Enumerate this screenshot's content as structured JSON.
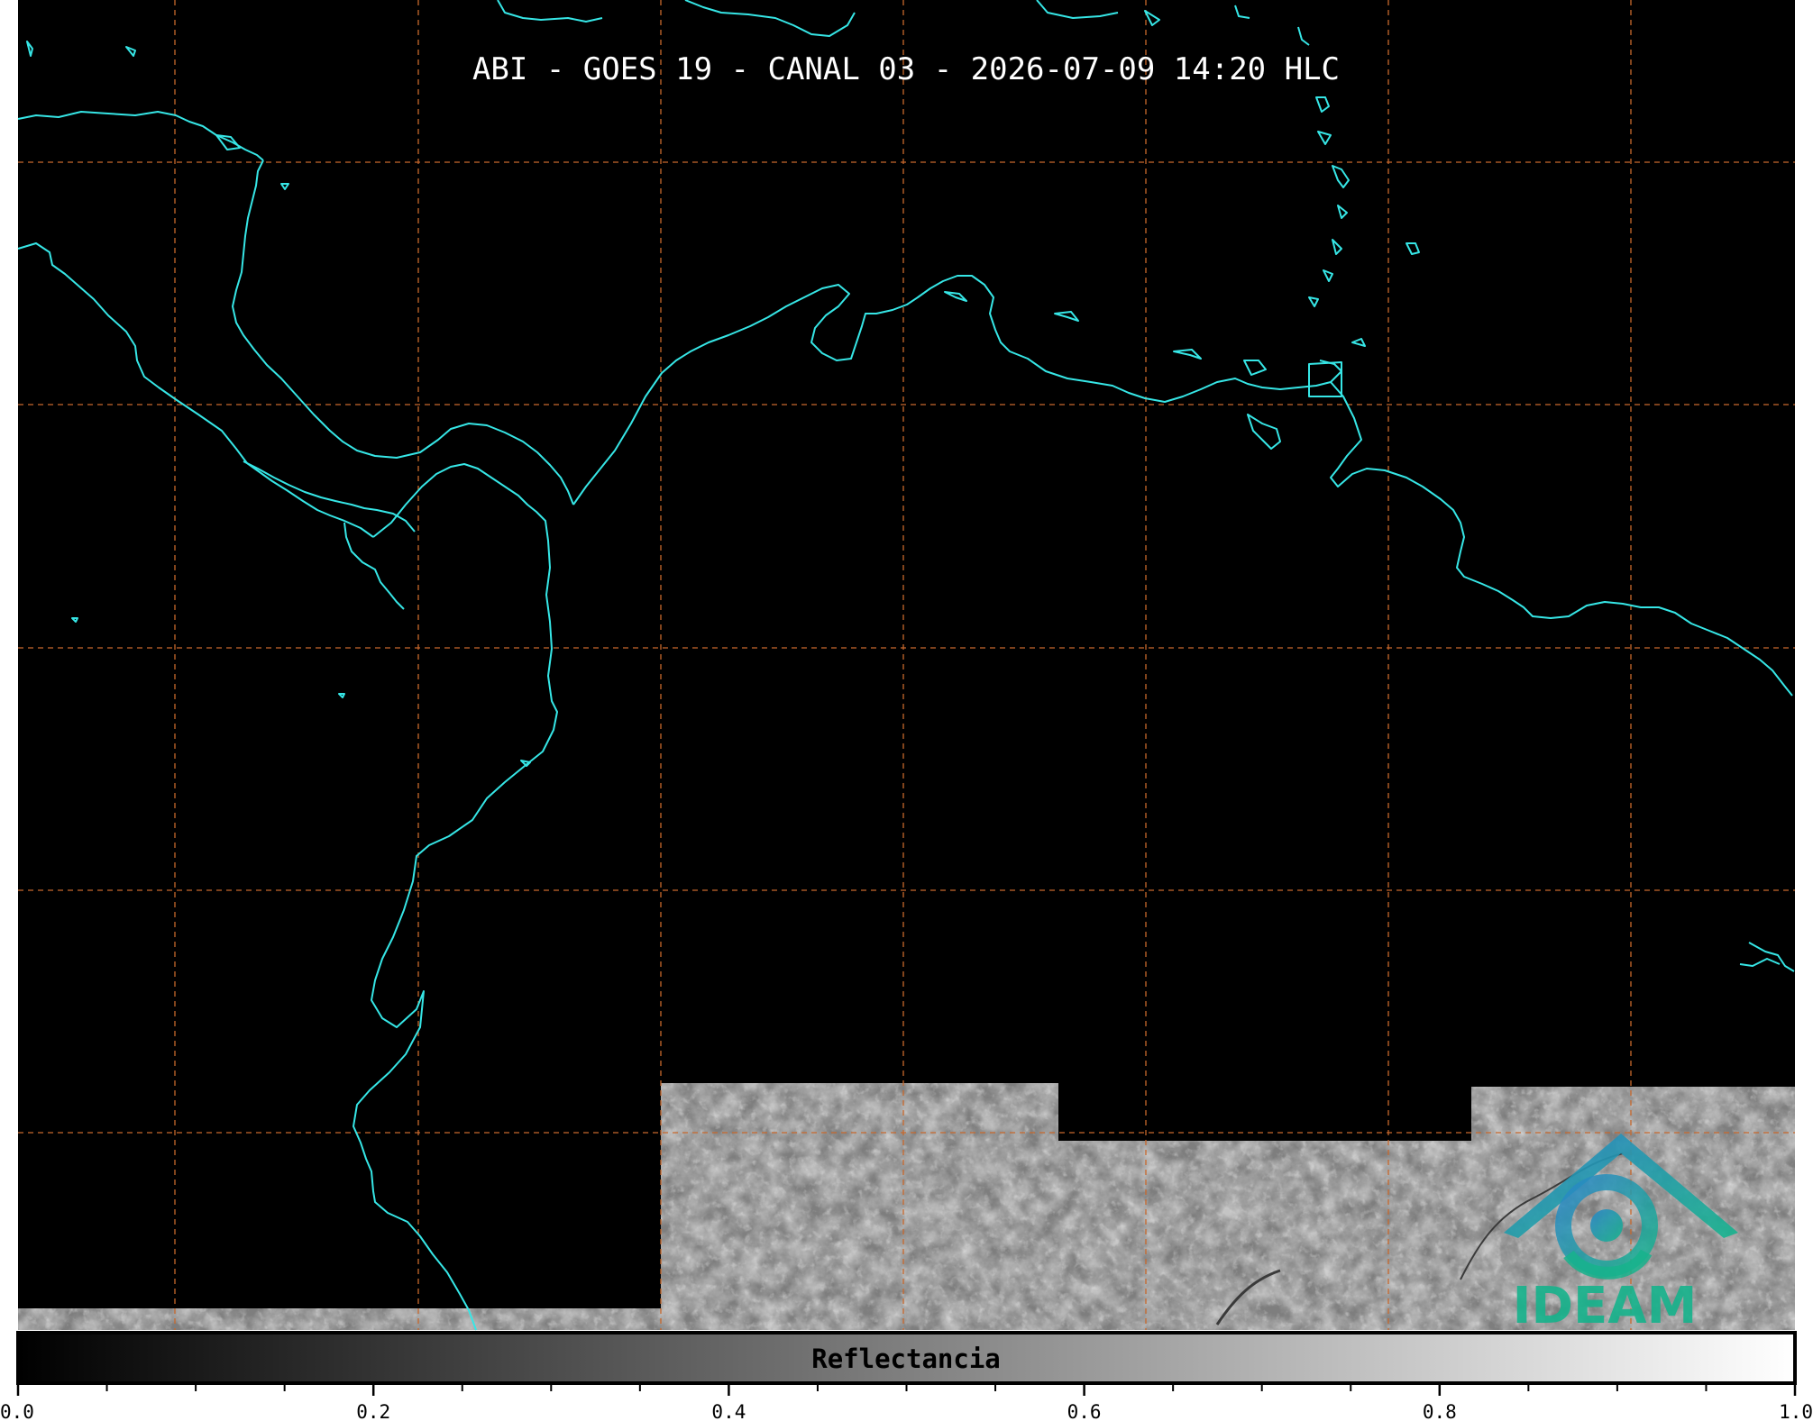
{
  "title": "ABI - GOES 19 - CANAL 03 - 2026-07-09 14:20 HLC",
  "colorbar": {
    "label": "Reflectancia",
    "min": 0.0,
    "max": 1.0,
    "ticks": [
      "0.0",
      "0.2",
      "0.4",
      "0.6",
      "0.8",
      "1.0"
    ],
    "minor_tick_step": 0.05
  },
  "logo": {
    "text": "IDEAM"
  },
  "colors": {
    "background": "#000000",
    "coastline": "#36e6e6",
    "gridlines": "#c8682c",
    "imagery": "#8a8a8a",
    "logo_blue": "#1f8fc4",
    "logo_teal": "#18b090"
  },
  "icons": [
    "ideam-logo-icon"
  ]
}
